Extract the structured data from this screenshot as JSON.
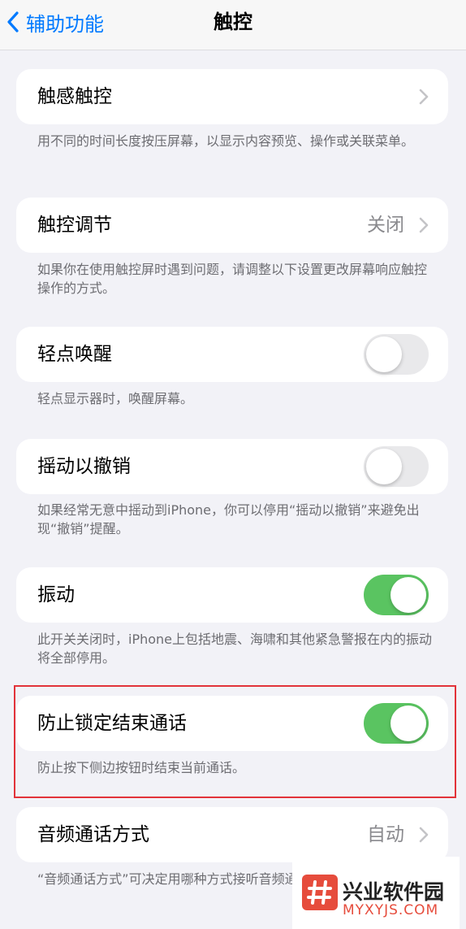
{
  "nav": {
    "back_label": "辅助功能",
    "title": "触控"
  },
  "rows": [
    {
      "label": "触感触控",
      "footer": "用不同的时间长度按压屏幕，以显示内容预览、操作或关联菜单。"
    },
    {
      "label": "触控调节",
      "value": "关闭",
      "footer": "如果你在使用触控屏时遇到问题，请调整以下设置更改屏幕响应触控操作的方式。"
    },
    {
      "label": "轻点唤醒",
      "toggle": false,
      "footer": "轻点显示器时，唤醒屏幕。"
    },
    {
      "label": "摇动以撤销",
      "toggle": false,
      "footer": "如果经常无意中摇动到iPhone，你可以停用“摇动以撤销”来避免出现“撤销”提醒。"
    },
    {
      "label": "振动",
      "toggle": true,
      "footer": "此开关关闭时，iPhone上包括地震、海啸和其他紧急警报在内的振动将全部停用。"
    },
    {
      "label": "防止锁定结束通话",
      "toggle": true,
      "footer": "防止按下侧边按钮时结束当前通话。"
    },
    {
      "label": "音频通话方式",
      "value": "自动",
      "footer": "“音频通话方式”可决定用哪种方式接听音频通话。"
    }
  ],
  "watermark": {
    "title": "兴业软件园",
    "subtitle": "MYXYJS.COM"
  },
  "colors": {
    "accent": "#007aff",
    "toggle_on": "#5ac461",
    "highlight": "#e2333a"
  }
}
